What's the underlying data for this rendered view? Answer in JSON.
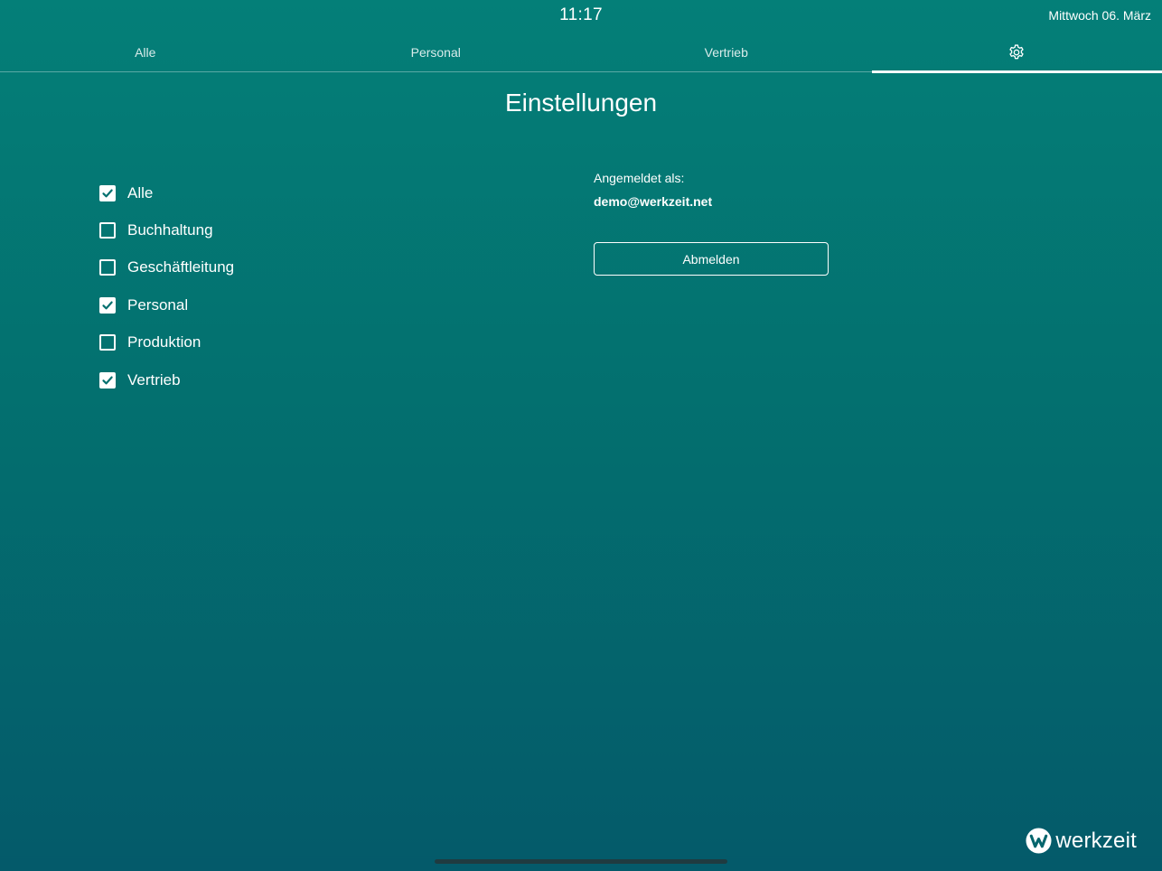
{
  "status_bar": {
    "time": "11:17",
    "date": "Mittwoch 06. März"
  },
  "tabs": [
    {
      "label": "Alle",
      "active": false
    },
    {
      "label": "Personal",
      "active": false
    },
    {
      "label": "Vertrieb",
      "active": false
    },
    {
      "label": "",
      "icon": "gear-icon",
      "active": true
    }
  ],
  "page": {
    "title": "Einstellungen"
  },
  "filters": [
    {
      "label": "Alle",
      "checked": true
    },
    {
      "label": "Buchhaltung",
      "checked": false
    },
    {
      "label": "Geschäftleitung",
      "checked": false
    },
    {
      "label": "Personal",
      "checked": true
    },
    {
      "label": "Produktion",
      "checked": false
    },
    {
      "label": "Vertrieb",
      "checked": true
    }
  ],
  "account": {
    "caption": "Angemeldet als:",
    "email": "demo@werkzeit.net",
    "logout_label": "Abmelden"
  },
  "brand": {
    "name": "werkzeit",
    "icon": "werkzeit-logo-icon"
  },
  "colors": {
    "background_top": "#047f78",
    "background_bottom": "#045a6a",
    "foreground": "#ffffff",
    "check_mark": "#05706f"
  }
}
